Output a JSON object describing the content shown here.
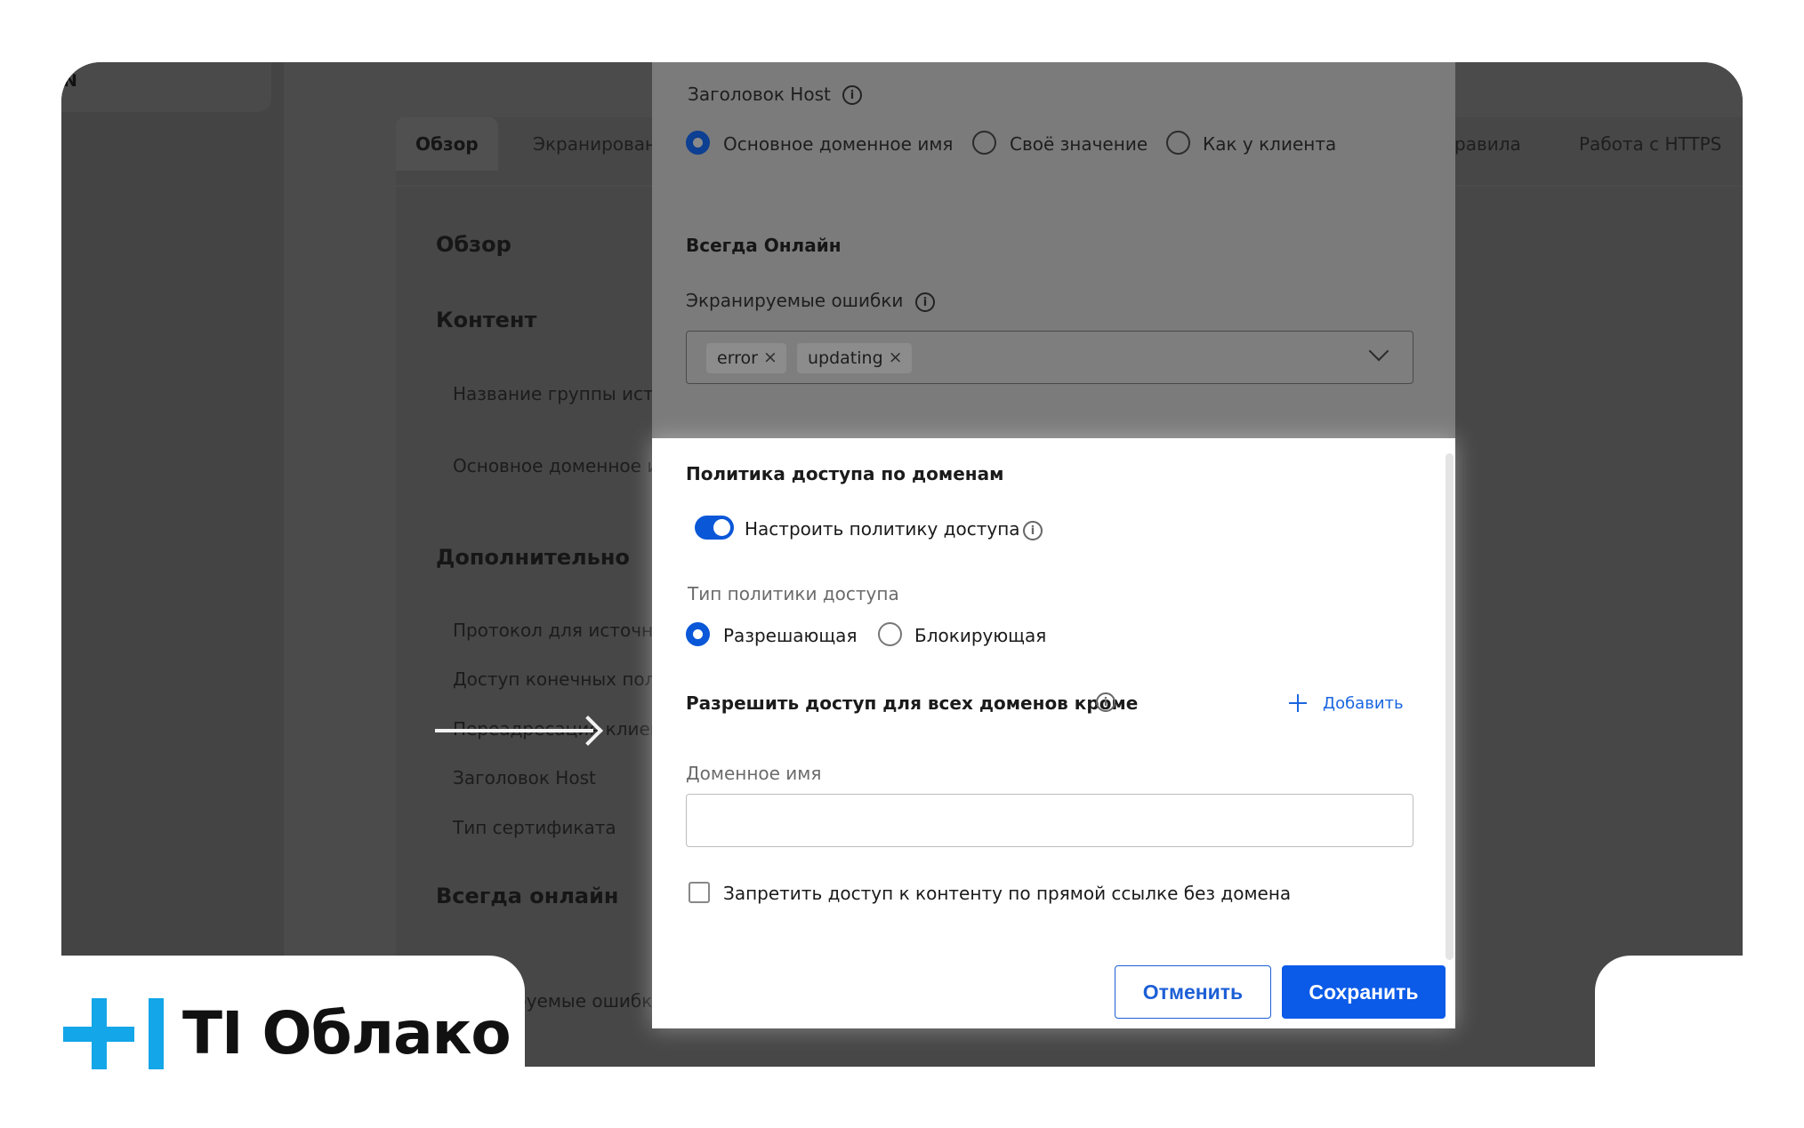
{
  "background": {
    "corner_text": "N",
    "tabs": [
      "Обзор",
      "Экранирован",
      "равила",
      "Работа с HTTPS"
    ],
    "sections": {
      "overview": "Обзор",
      "content": "Контент",
      "additional": "Дополнительно",
      "always_online": "Всегда онлайн"
    },
    "items": {
      "source_group": "Название группы исто",
      "main_domain": "Основное доменное и",
      "protocol": "Протокол для источн",
      "end_access": "Доступ конечных пол",
      "redirect": "Переадресация клиен",
      "host_header": "Заголовок Host",
      "cert_type": "Тип сертификата",
      "shielded_errors": "руемые ошибк"
    }
  },
  "modal": {
    "host_header_label": "Заголовок Host",
    "host_options": [
      "Основное доменное имя",
      "Своё значение",
      "Как у клиента"
    ],
    "always_online_title": "Всегда Онлайн",
    "shielded_errors_label": "Экранируемые ошибки",
    "error_chips": [
      "error",
      "updating"
    ],
    "policy_title": "Политика доступа по доменам",
    "toggle_label": "Настроить политику доступа",
    "policy_type_label": "Тип политики доступа",
    "policy_type_options": [
      "Разрешающая",
      "Блокирующая"
    ],
    "allow_label": "Разрешить доступ для всех доменов кроме",
    "add_label": "Добавить",
    "domain_name_label": "Доменное имя",
    "domain_name_value": "",
    "checkbox_label": "Запретить доступ к контенту по прямой ссылке без домена",
    "cancel_label": "Отменить",
    "save_label": "Сохранить"
  },
  "brand": {
    "name": "TI Облако"
  },
  "colors": {
    "accent": "#0b5be8",
    "brand": "#13a6e8"
  },
  "icons": [
    "info-icon",
    "close-icon",
    "chevron-down-icon",
    "plus-icon",
    "arrow-right-icon"
  ]
}
